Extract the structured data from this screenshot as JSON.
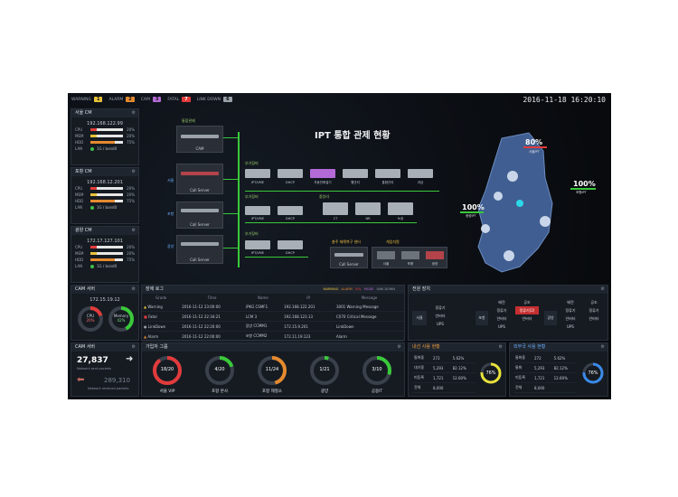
{
  "status_bar": [
    {
      "label": "WARNING",
      "count": "1",
      "color": "#e8c33a"
    },
    {
      "label": "ALARM",
      "count": "2",
      "color": "#e58a2e"
    },
    {
      "label": "CAM",
      "count": "3",
      "color": "#b36ad6"
    },
    {
      "label": "FATAL",
      "count": "7",
      "color": "#e23b3b"
    },
    {
      "label": "LINK DOWN",
      "count": "6",
      "color": "#9aa1aa"
    }
  ],
  "clock": "2016-11-18 16:20:10",
  "left_panels": [
    {
      "title": "서울 CM",
      "ip": "192.168.122.99",
      "metrics": [
        {
          "label": "CPU",
          "value": "20%",
          "fill": 0.2,
          "color": "#e23b3b"
        },
        {
          "label": "MEM",
          "value": "20%",
          "fill": 0.2,
          "color": "#e8c33a"
        },
        {
          "label": "HDD",
          "value": "75%",
          "fill": 0.75,
          "color": "#e58a2e"
        }
      ],
      "lan": "1G / bond0"
    },
    {
      "title": "포항 CM",
      "ip": "192.168.12.201",
      "metrics": [
        {
          "label": "CPU",
          "value": "20%",
          "fill": 0.2,
          "color": "#e23b3b"
        },
        {
          "label": "MEM",
          "value": "20%",
          "fill": 0.2,
          "color": "#e8c33a"
        },
        {
          "label": "HDD",
          "value": "75%",
          "fill": 0.75,
          "color": "#e58a2e"
        }
      ],
      "lan": "1G / bond0"
    },
    {
      "title": "광양 CM",
      "ip": "172.17.127.101",
      "metrics": [
        {
          "label": "CPU",
          "value": "20%",
          "fill": 0.2,
          "color": "#e23b3b"
        },
        {
          "label": "MEM",
          "value": "20%",
          "fill": 0.2,
          "color": "#e8c33a"
        },
        {
          "label": "HDD",
          "value": "75%",
          "fill": 0.75,
          "color": "#e58a2e"
        }
      ],
      "lan": "1G / bond0"
    }
  ],
  "center_title": "IPT 통합 관제 현황",
  "topology": {
    "cam_label": "통합관제",
    "cam_device": "CAM",
    "sites": [
      "서울",
      "포항",
      "광양"
    ],
    "call_server": "Call Server",
    "branch_label": "부가장비",
    "row1": [
      "IPT/VME",
      "DHCP",
      "자동전화걸기",
      "웹관리",
      "통합관리",
      "과금"
    ],
    "row2": [
      "IPT/VME",
      "DHCP"
    ],
    "row2_group": "중앙라",
    "row2_right": [
      "CT",
      "NR",
      "녹취"
    ],
    "row3": [
      "IPT/VME",
      "DHCP"
    ],
    "disaster_title": "충주 재해복구 센터",
    "disaster_device": "Call Server",
    "switch_title": "게임지원",
    "switch_items": [
      "서울",
      "포항",
      "광양"
    ]
  },
  "map": {
    "seoul_pct": "80%",
    "seoul_sub": "서울IPT",
    "pohang_pct": "100%",
    "pohang_sub": "포항IPT",
    "gwangyang_pct": "100%",
    "gwangyang_sub": "광양IPT"
  },
  "cam_server": {
    "title": "CAM 서버",
    "ip": "172.15.19.12",
    "cpu_label": "CPU",
    "cpu_value": "20%",
    "cpu_fill": 0.2,
    "mem_label": "Memory",
    "mem_value": "42%",
    "mem_fill": 0.42
  },
  "alarm_log": {
    "title": "장애 로그",
    "filters": [
      "WARNING",
      "ALARM",
      "FAIL",
      "MODE",
      "LINK DOWN"
    ],
    "headers": [
      "Grade",
      "Time",
      "Name",
      "IP",
      "Message"
    ],
    "rows": [
      {
        "grade": "Warning",
        "time": "2016-11-12 23:00:00",
        "name": "/PKG CSMF1",
        "ip": "192.168.122.201",
        "message": "3001 Warning Message",
        "color": "#e8c33a"
      },
      {
        "grade": "Fatal",
        "time": "2016-11-12 22:34:21",
        "name": "LCM 3",
        "ip": "192.168.123.13",
        "message": "C070 Critical Message",
        "color": "#e23b3b"
      },
      {
        "grade": "LinkDown",
        "time": "2016-11-12 22:20:00",
        "name": "광양 CCMM1",
        "ip": "172.15.9.201",
        "message": "LinkDown",
        "color": "#9aa1aa"
      },
      {
        "grade": "Alarm",
        "time": "2016-11-12 22:00:00",
        "name": "포항 CCMM2",
        "ip": "172.11.19.123",
        "message": "Alarm",
        "color": "#e58a2e"
      }
    ]
  },
  "power_status": {
    "title": "전원 장치",
    "sites": [
      {
        "name": "서울",
        "cols": [
          [
            "정류기",
            "안버터",
            "UPS"
          ],
          [
            "",
            "",
            ""
          ]
        ]
      },
      {
        "name": "포항",
        "cols": [
          [
            "배전",
            "정류기",
            "안버터",
            "UPS"
          ],
          [
            "공조",
            "정류기(2)",
            "안버터",
            ""
          ]
        ]
      },
      {
        "name": "광양",
        "cols": [
          [
            "배전",
            "정류기",
            "안버터",
            "UPS"
          ],
          [
            "공조",
            "정류기",
            "안버터",
            ""
          ]
        ]
      }
    ],
    "alert_item": "정류기(2)"
  },
  "cam_summary": {
    "title": "CAM 서버",
    "sent": "27,837",
    "sent_label": "Network sent packets",
    "received": "289,310",
    "received_label": "Network received packets"
  },
  "subscriber_groups": {
    "title": "가입자 그룹",
    "items": [
      {
        "value": "18/20",
        "label": "서울 VIP",
        "fill": 0.9,
        "color": "#e23b3b"
      },
      {
        "value": "4/20",
        "label": "포항 본사",
        "fill": 0.2,
        "color": "#3ac93a"
      },
      {
        "value": "11/24",
        "label": "포항 제철소",
        "fill": 0.46,
        "color": "#e58a2e"
      },
      {
        "value": "1/21",
        "label": "광양",
        "fill": 0.05,
        "color": "#3ac93a"
      },
      {
        "value": "3/10",
        "label": "공용IT",
        "fill": 0.3,
        "color": "#3ac93a"
      }
    ]
  },
  "internal_usage": {
    "title": "내선 사용 현황",
    "rows": [
      [
        "통화중",
        "272",
        "5.62%"
      ],
      [
        "대기중",
        "5,293",
        "82.12%"
      ],
      [
        "미등록",
        "1,721",
        "12.60%"
      ],
      [
        "전체",
        "8,000",
        ""
      ]
    ],
    "ring_value": "76%",
    "ring_fill": 0.76,
    "ring_color": "#e8e23a"
  },
  "external_usage": {
    "title": "외부국 사용 현황",
    "rows": [
      [
        "통화중",
        "272",
        "5.62%"
      ],
      [
        "통화",
        "5,293",
        "82.12%"
      ],
      [
        "미등록",
        "1,721",
        "12.60%"
      ],
      [
        "전체",
        "8,000",
        ""
      ]
    ],
    "ring_value": "76%",
    "ring_fill": 0.76,
    "ring_color": "#3a8ae8"
  }
}
